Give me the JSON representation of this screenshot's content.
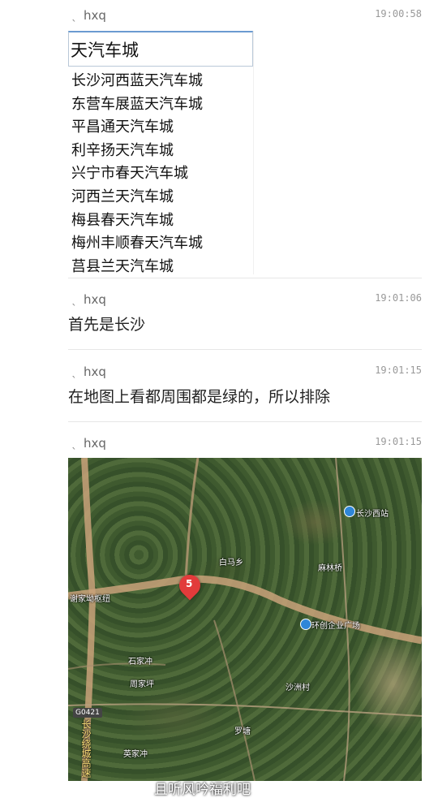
{
  "messages": [
    {
      "sender": "hxq",
      "time": "19:00:58"
    },
    {
      "sender": "hxq",
      "time": "19:01:06",
      "text": "首先是长沙"
    },
    {
      "sender": "hxq",
      "time": "19:01:15",
      "text": "在地图上看都周围都是绿的，所以排除"
    },
    {
      "sender": "hxq",
      "time": "19:01:15"
    }
  ],
  "search_shot": {
    "query": "天汽车城",
    "suggestions": [
      "长沙河西蓝天汽车城",
      "东营车展蓝天汽车城",
      "平昌通天汽车城",
      "利辛扬天汽车城",
      "兴宁市春天汽车城",
      "河西兰天汽车城",
      "梅县春天汽车城",
      "梅州丰顺春天汽车城",
      "莒县兰天汽车城"
    ]
  },
  "map": {
    "labels": {
      "changsha_west": "长沙西站",
      "baima": "白马乡",
      "junction": "谢家坳枢纽",
      "park": "环创企业广场",
      "shiping": "石家冲",
      "zhouping": "周家坪",
      "shagou": "沙洲村",
      "luyuan": "罗塘",
      "yingjia": "英家冲",
      "expressway": "长沙绕城高速",
      "road_g": "G0421",
      "village": "麻林桥"
    },
    "pin_number": "5"
  },
  "caption": "且听风吟福利吧",
  "colors": {
    "pin": "#e23b3b",
    "poi": "#2f86d8"
  }
}
